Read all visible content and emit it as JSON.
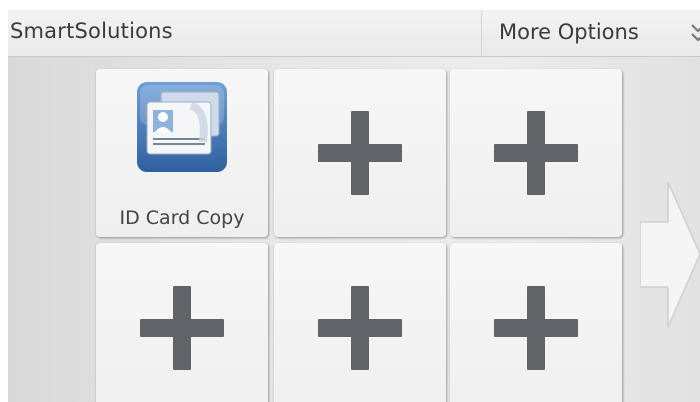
{
  "header": {
    "title": "SmartSolutions",
    "more_options_label": "More Options"
  },
  "tiles": [
    {
      "label": "ID Card Copy",
      "icon": "id-card-icon"
    },
    {
      "label": "",
      "icon": "plus-icon"
    },
    {
      "label": "",
      "icon": "plus-icon"
    },
    {
      "label": "",
      "icon": "plus-icon"
    },
    {
      "label": "",
      "icon": "plus-icon"
    },
    {
      "label": "",
      "icon": "plus-icon"
    }
  ],
  "navigation": {
    "next_icon": "arrow-right-icon"
  },
  "colors": {
    "plus": "#5f6469",
    "tile": "#f3f3f3",
    "id_card_blue": "#4a7fc0"
  }
}
